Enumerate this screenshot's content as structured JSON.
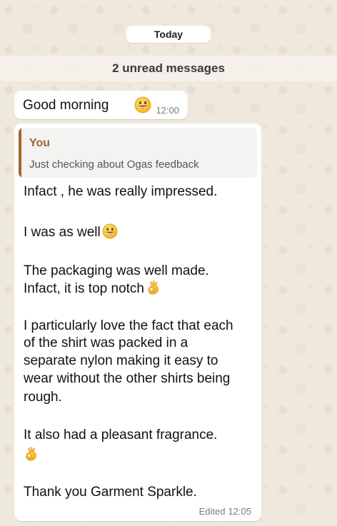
{
  "date_separator": "Today",
  "unread_banner": "2 unread messages",
  "message_1": {
    "text": "Good morning",
    "emoji": "grinning-face",
    "time": "12:00"
  },
  "message_2": {
    "quote": {
      "author": "You",
      "text": "Just checking about Ogas feedback"
    },
    "lines": [
      "Infact , he was really impressed.",
      "I was as well",
      "The packaging was well made.",
      "Infact, it is top notch",
      "I particularly love the fact that each",
      "of the shirt was packed in a",
      "separate nylon making it easy to",
      "wear without the other shirts being",
      "rough.",
      "It also had a pleasant fragrance.",
      "Thank you Garment Sparkle."
    ],
    "emojis": [
      "grinning-face",
      "ok-hand",
      "ok-hand"
    ],
    "edited_label": "Edited",
    "time": "12:05"
  },
  "colors": {
    "quote_accent": "#a5652c",
    "bubble": "#ffffff",
    "wallpaper": "#efe8dd"
  }
}
